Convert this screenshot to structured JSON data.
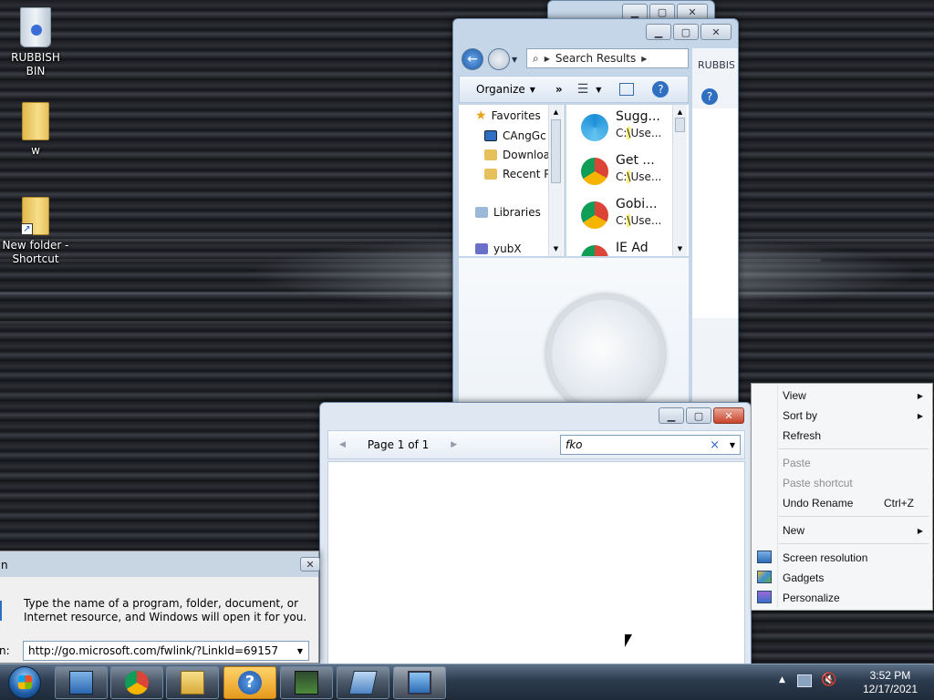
{
  "desktop": {
    "icons": [
      {
        "label": "RUBBISH BIN"
      },
      {
        "label": "w"
      },
      {
        "label": "New folder -\nShortcut"
      }
    ]
  },
  "explorer": {
    "address": "Search Results",
    "background_window_label": "RUBBIS",
    "toolbar": {
      "organize": "Organize",
      "more": "»"
    },
    "nav": {
      "favorites": "Favorites",
      "items": [
        "CAngGc",
        "Downloa",
        "Recent P"
      ],
      "libraries": "Libraries",
      "partial": "yubX"
    },
    "files": [
      {
        "name": "Sugg...",
        "path_prefix": "C:",
        "path_hl": "\\",
        "path_rest": "Use..."
      },
      {
        "name": "Get ...",
        "path_prefix": "C:",
        "path_hl": "\\",
        "path_rest": "Use..."
      },
      {
        "name": "Gobi...",
        "path_prefix": "C:",
        "path_hl": "\\",
        "path_rest": "Use..."
      },
      {
        "name": "IE Ad",
        "path_prefix": "",
        "path_hl": "",
        "path_rest": ""
      }
    ]
  },
  "print_preview": {
    "page_label": "Page 1 of 1",
    "search_value": "fko",
    "clear_glyph": "×"
  },
  "run_dialog": {
    "title_fragment": "n",
    "description": "Type the name of a program, folder, document, or Internet resource, and Windows will open it for you.",
    "open_label": "n:",
    "input_value": "http://go.microsoft.com/fwlink/?LinkId=69157"
  },
  "context_menu": {
    "items": [
      {
        "label": "View",
        "submenu": true
      },
      {
        "label": "Sort by",
        "submenu": true
      },
      {
        "label": "Refresh"
      },
      {
        "label": "Paste",
        "disabled": true
      },
      {
        "label": "Paste shortcut",
        "disabled": true
      },
      {
        "label": "Undo Rename",
        "shortcut": "Ctrl+Z"
      },
      {
        "label": "New",
        "submenu": true
      },
      {
        "label": "Screen resolution"
      },
      {
        "label": "Gadgets"
      },
      {
        "label": "Personalize"
      }
    ]
  },
  "taskbar": {
    "apps": [
      "control-panel",
      "chrome",
      "file-explorer",
      "help",
      "task-manager",
      "remote-desktop",
      "display-settings"
    ],
    "clock_time": "3:52 PM",
    "clock_date": "12/17/2021"
  },
  "colors": {
    "accent": "#1f5fa8",
    "highlight": "#ffef7a",
    "close": "#c7422b"
  }
}
